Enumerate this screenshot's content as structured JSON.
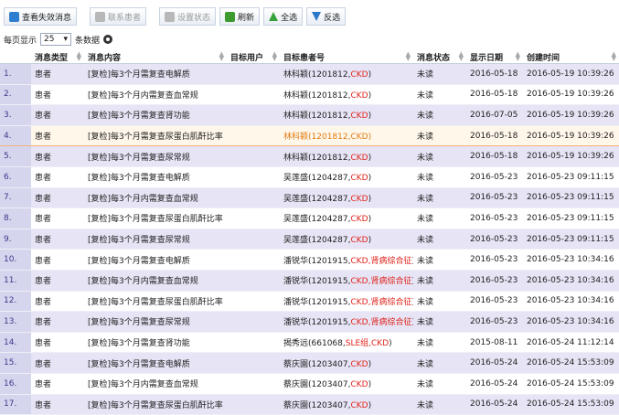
{
  "toolbar": {
    "view_invalid": "查看失效消息",
    "contact_patient": "联系患者",
    "set_status": "设置状态",
    "refresh": "刷新",
    "select_all": "全选",
    "invert": "反选"
  },
  "pager": {
    "prefix": "每页显示",
    "value": "25",
    "suffix": "条数据"
  },
  "columns": [
    "",
    "消息类型",
    "消息内容",
    "目标用户",
    "目标患者号",
    "消息状态",
    "显示日期",
    "创建时间"
  ],
  "rows": [
    {
      "idx": "1.",
      "type": "患者",
      "content": "[复检]每3个月需复查电解质",
      "user": "",
      "p_name": "林科颖(1201812,",
      "p_tag": "CKD",
      "p_end": ")",
      "status": "未读",
      "show": "2016-05-18",
      "created": "2016-05-19 10:39:26"
    },
    {
      "idx": "2.",
      "type": "患者",
      "content": "[复检]每3个月内需复查血常规",
      "user": "",
      "p_name": "林科颖(1201812,",
      "p_tag": "CKD",
      "p_end": ")",
      "status": "未读",
      "show": "2016-05-18",
      "created": "2016-05-19 10:39:26"
    },
    {
      "idx": "3.",
      "type": "患者",
      "content": "[复检]每3个月需复查肾功能",
      "user": "",
      "p_name": "林科颖(1201812,",
      "p_tag": "CKD",
      "p_end": ")",
      "status": "未读",
      "show": "2016-07-05",
      "created": "2016-05-19 10:39:26"
    },
    {
      "idx": "4.",
      "type": "患者",
      "content": "[复检]每3个月需复查尿蛋白肌酐比率",
      "user": "",
      "p_name": "林科颖(1201812,",
      "p_tag": "CKD",
      "p_end": ")",
      "status": "未读",
      "show": "2016-05-18",
      "created": "2016-05-19 10:39:26"
    },
    {
      "idx": "5.",
      "type": "患者",
      "content": "[复检]每3个月需复查尿常规",
      "user": "",
      "p_name": "林科颖(1201812,",
      "p_tag": "CKD",
      "p_end": ")",
      "status": "未读",
      "show": "2016-05-18",
      "created": "2016-05-19 10:39:26"
    },
    {
      "idx": "6.",
      "type": "患者",
      "content": "[复检]每3个月需复查电解质",
      "user": "",
      "p_name": "吴莲盛(1204287,",
      "p_tag": "CKD",
      "p_end": ")",
      "status": "未读",
      "show": "2016-05-23",
      "created": "2016-05-23 09:11:15"
    },
    {
      "idx": "7.",
      "type": "患者",
      "content": "[复检]每3个月内需复查血常规",
      "user": "",
      "p_name": "吴莲盛(1204287,",
      "p_tag": "CKD",
      "p_end": ")",
      "status": "未读",
      "show": "2016-05-23",
      "created": "2016-05-23 09:11:15"
    },
    {
      "idx": "8.",
      "type": "患者",
      "content": "[复检]每3个月需复查尿蛋白肌酐比率",
      "user": "",
      "p_name": "吴莲盛(1204287,",
      "p_tag": "CKD",
      "p_end": ")",
      "status": "未读",
      "show": "2016-05-23",
      "created": "2016-05-23 09:11:15"
    },
    {
      "idx": "9.",
      "type": "患者",
      "content": "[复检]每3个月需复查尿常规",
      "user": "",
      "p_name": "吴莲盛(1204287,",
      "p_tag": "CKD",
      "p_end": ")",
      "status": "未读",
      "show": "2016-05-23",
      "created": "2016-05-23 09:11:15"
    },
    {
      "idx": "10.",
      "type": "患者",
      "content": "[复检]每3个月需复查电解质",
      "user": "",
      "p_name": "潘锐华(1201915,",
      "p_tag": "CKD,肾病综合征",
      "p_end": ")",
      "status": "未读",
      "show": "2016-05-23",
      "created": "2016-05-23 10:34:16"
    },
    {
      "idx": "11.",
      "type": "患者",
      "content": "[复检]每3个月内需复查血常规",
      "user": "",
      "p_name": "潘锐华(1201915,",
      "p_tag": "CKD,肾病综合征",
      "p_end": ")",
      "status": "未读",
      "show": "2016-05-23",
      "created": "2016-05-23 10:34:16"
    },
    {
      "idx": "12.",
      "type": "患者",
      "content": "[复检]每3个月需复查尿蛋白肌酐比率",
      "user": "",
      "p_name": "潘锐华(1201915,",
      "p_tag": "CKD,肾病综合征",
      "p_end": ")",
      "status": "未读",
      "show": "2016-05-23",
      "created": "2016-05-23 10:34:16"
    },
    {
      "idx": "13.",
      "type": "患者",
      "content": "[复检]每3个月需复查尿常规",
      "user": "",
      "p_name": "潘锐华(1201915,",
      "p_tag": "CKD,肾病综合征",
      "p_end": ")",
      "status": "未读",
      "show": "2016-05-23",
      "created": "2016-05-23 10:34:16"
    },
    {
      "idx": "14.",
      "type": "患者",
      "content": "[复检]每3个月需复查肾功能",
      "user": "",
      "p_name": "揭秀远(661068,",
      "p_tag": "SLE组,CKD",
      "p_end": ")",
      "status": "未读",
      "show": "2015-08-11",
      "created": "2016-05-24 11:12:14"
    },
    {
      "idx": "15.",
      "type": "患者",
      "content": "[复检]每3个月需复查电解质",
      "user": "",
      "p_name": "蔡庆園(1203407,",
      "p_tag": "CKD",
      "p_end": ")",
      "status": "未读",
      "show": "2016-05-24",
      "created": "2016-05-24 15:53:09"
    },
    {
      "idx": "16.",
      "type": "患者",
      "content": "[复检]每3个月内需复查血常规",
      "user": "",
      "p_name": "蔡庆園(1203407,",
      "p_tag": "CKD",
      "p_end": ")",
      "status": "未读",
      "show": "2016-05-24",
      "created": "2016-05-24 15:53:09"
    },
    {
      "idx": "17.",
      "type": "患者",
      "content": "[复检]每3个月需复查尿蛋白肌酐比率",
      "user": "",
      "p_name": "蔡庆園(1203407,",
      "p_tag": "CKD",
      "p_end": ")",
      "status": "未读",
      "show": "2016-05-24",
      "created": "2016-05-24 15:53:09"
    }
  ],
  "colors": {
    "tag_red": "#e0241b",
    "highlight_text": "#e07b12",
    "odd_row": "#e6e4f5"
  },
  "highlighted_row": 3
}
